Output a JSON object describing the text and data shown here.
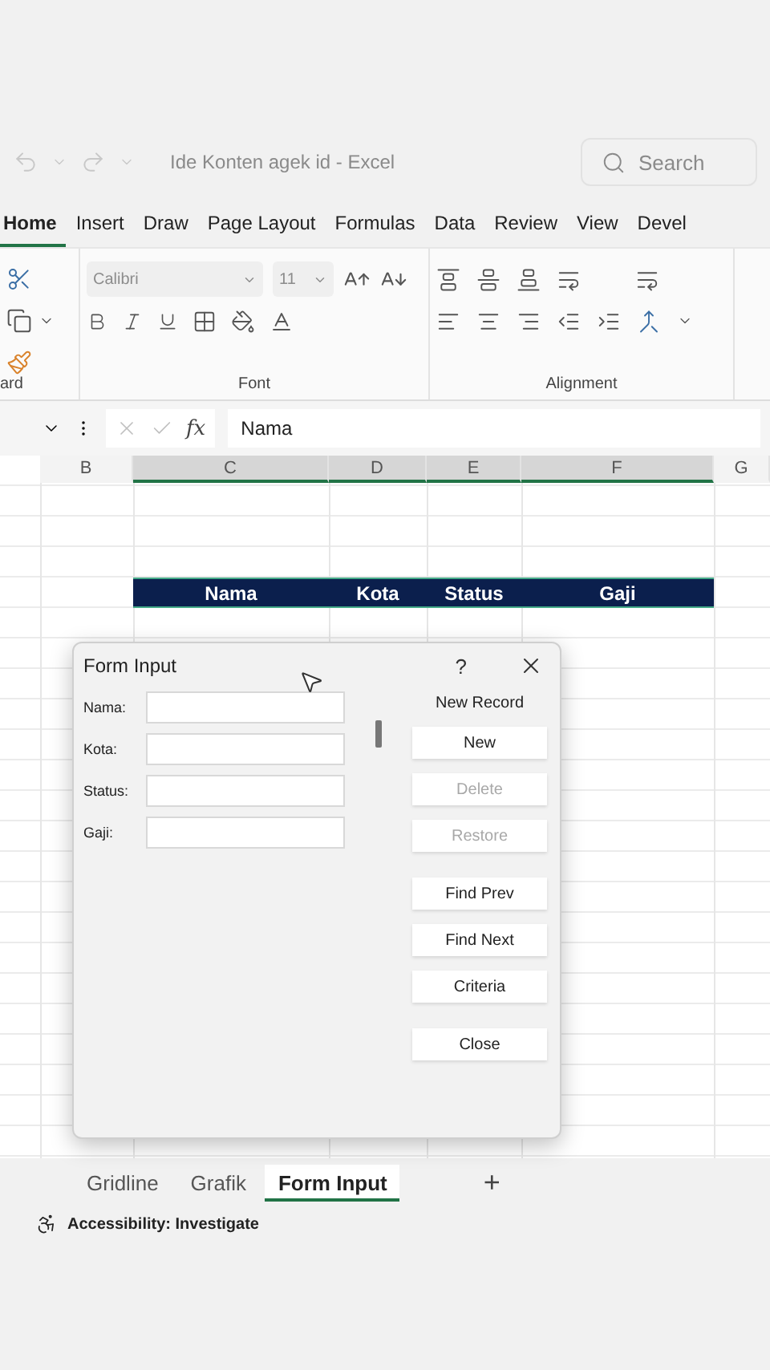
{
  "title_bar": {
    "title": "Ide Konten agek id  -  Excel",
    "search_placeholder": "Search"
  },
  "ribbon_tabs": [
    {
      "label": "Home",
      "selected": true
    },
    {
      "label": "Insert",
      "selected": false
    },
    {
      "label": "Draw",
      "selected": false
    },
    {
      "label": "Page Layout",
      "selected": false
    },
    {
      "label": "Formulas",
      "selected": false
    },
    {
      "label": "Data",
      "selected": false
    },
    {
      "label": "Review",
      "selected": false
    },
    {
      "label": "View",
      "selected": false
    },
    {
      "label": "Devel",
      "selected": false
    }
  ],
  "ribbon": {
    "font_name": "Calibri",
    "font_size": "11",
    "groups": [
      "ard",
      "Font",
      "Alignment"
    ]
  },
  "formula_bar": {
    "function_label": "fx",
    "value": "Nama"
  },
  "columns": [
    {
      "label": "B",
      "selected": false
    },
    {
      "label": "C",
      "selected": true
    },
    {
      "label": "D",
      "selected": true
    },
    {
      "label": "E",
      "selected": true
    },
    {
      "label": "F",
      "selected": true
    },
    {
      "label": "G",
      "selected": false
    }
  ],
  "header_row": [
    "Nama",
    "Kota",
    "Status",
    "Gaji"
  ],
  "dialog": {
    "title": "Form Input",
    "help": "?",
    "record_label": "New Record",
    "fields": [
      {
        "label": "Nama:"
      },
      {
        "label": "Kota:"
      },
      {
        "label": "Status:"
      },
      {
        "label": "Gaji:"
      }
    ],
    "buttons": [
      {
        "label": "New",
        "disabled": false
      },
      {
        "label": "Delete",
        "disabled": true
      },
      {
        "label": "Restore",
        "disabled": true
      },
      {
        "label": "Find Prev",
        "disabled": false
      },
      {
        "label": "Find Next",
        "disabled": false
      },
      {
        "label": "Criteria",
        "disabled": false
      },
      {
        "label": "Close",
        "disabled": false
      }
    ]
  },
  "sheet_tabs": [
    {
      "label": "Gridline",
      "selected": false
    },
    {
      "label": "Grafik",
      "selected": false
    },
    {
      "label": "Form Input",
      "selected": true
    }
  ],
  "add_sheet": "+",
  "status": "Accessibility: Investigate"
}
